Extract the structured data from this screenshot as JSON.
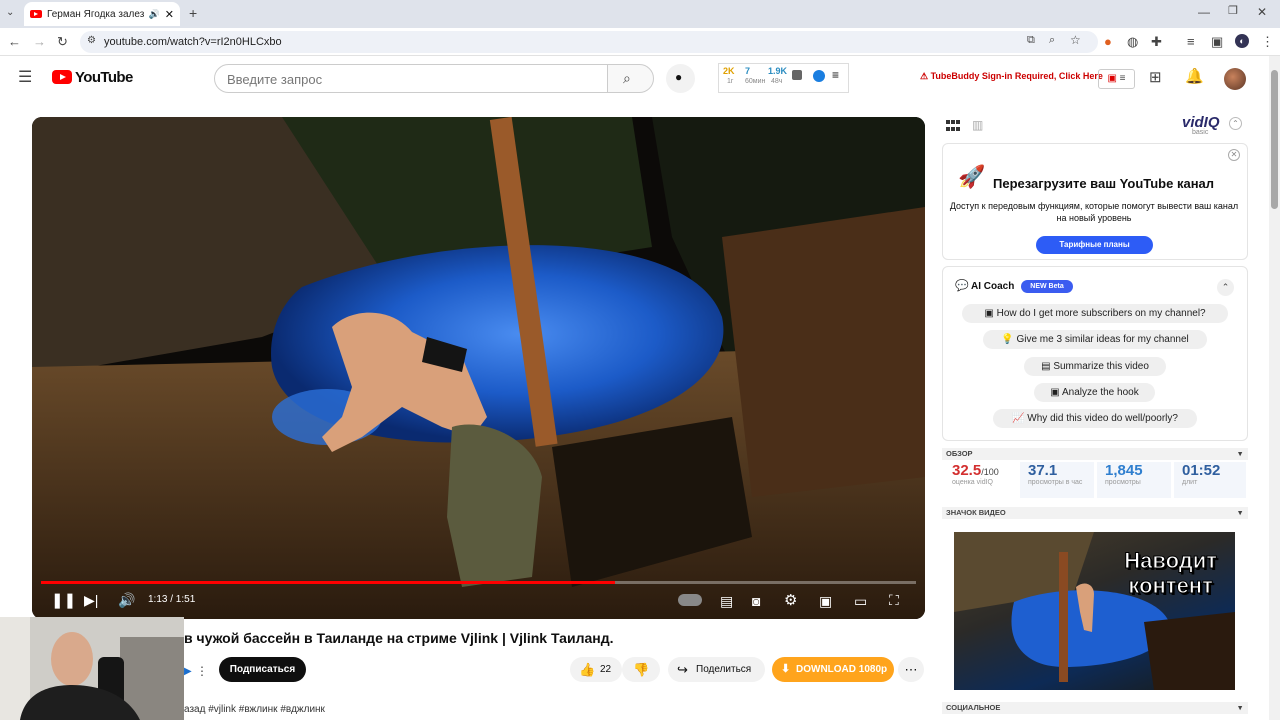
{
  "browser": {
    "tab_title": "Герман Ягодка залез в чужой",
    "url": "youtube.com/watch?v=rI2n0HLCxbo"
  },
  "youtube": {
    "logo_text": "YouTube",
    "search_placeholder": "Введите запрос",
    "tubebuddy_stats": {
      "s1_value": "2K",
      "s1_label": "1г",
      "s2_value": "7",
      "s2_label": "60мин",
      "s3_value": "1.9K",
      "s3_label": "48ч"
    },
    "tubebuddy_warning": "TubeBuddy Sign-in Required, Click Here"
  },
  "player": {
    "time": "1:13 / 1:51",
    "progress_fraction": 0.656
  },
  "video": {
    "title_visible": "в чужой бассейн в Таиланде на стриме Vjlink | Vjlink Таиланд.",
    "subscribe_label": "Подписаться",
    "likes": "22",
    "share_label": "Поделиться",
    "download_label": "DOWNLOAD 1080p",
    "hashtags_line": "азад  #vjlink #вжлинк #вджлинк"
  },
  "vidiq": {
    "logo": "vidIQ",
    "plan": "basic",
    "promo_title": "Перезагрузите ваш YouTube канал",
    "promo_text": "Доступ к передовым функциям, которые помогут вывести ваш канал на новый уровень",
    "plans_button": "Тарифные планы",
    "ai_coach_title": "AI Coach",
    "ai_coach_badge": "NEW Beta",
    "suggestions": [
      "How do I get more subscribers on my channel?",
      "Give me 3 similar ideas for my channel",
      "Summarize this video",
      "Analyze the hook",
      "Why did this video do well/poorly?"
    ],
    "overview_header": "ОБЗОР",
    "stats": [
      {
        "value": "32.5",
        "suffix": "/100",
        "label": "оценка vidIQ",
        "color": "#d32f2f"
      },
      {
        "value": "37.1",
        "suffix": "",
        "label": "просмотры в час",
        "color": "#2f5f9f"
      },
      {
        "value": "1,845",
        "suffix": "",
        "label": "просмотры",
        "color": "#2f7fcf"
      },
      {
        "value": "01:52",
        "suffix": "",
        "label": "длит",
        "color": "#2f5f9f"
      }
    ],
    "thumbnail_header": "ЗНАЧОК ВИДЕО",
    "thumbnail_text_line1": "Наводит",
    "thumbnail_text_line2": "контент",
    "social_header": "СОЦИАЛЬНОЕ"
  }
}
